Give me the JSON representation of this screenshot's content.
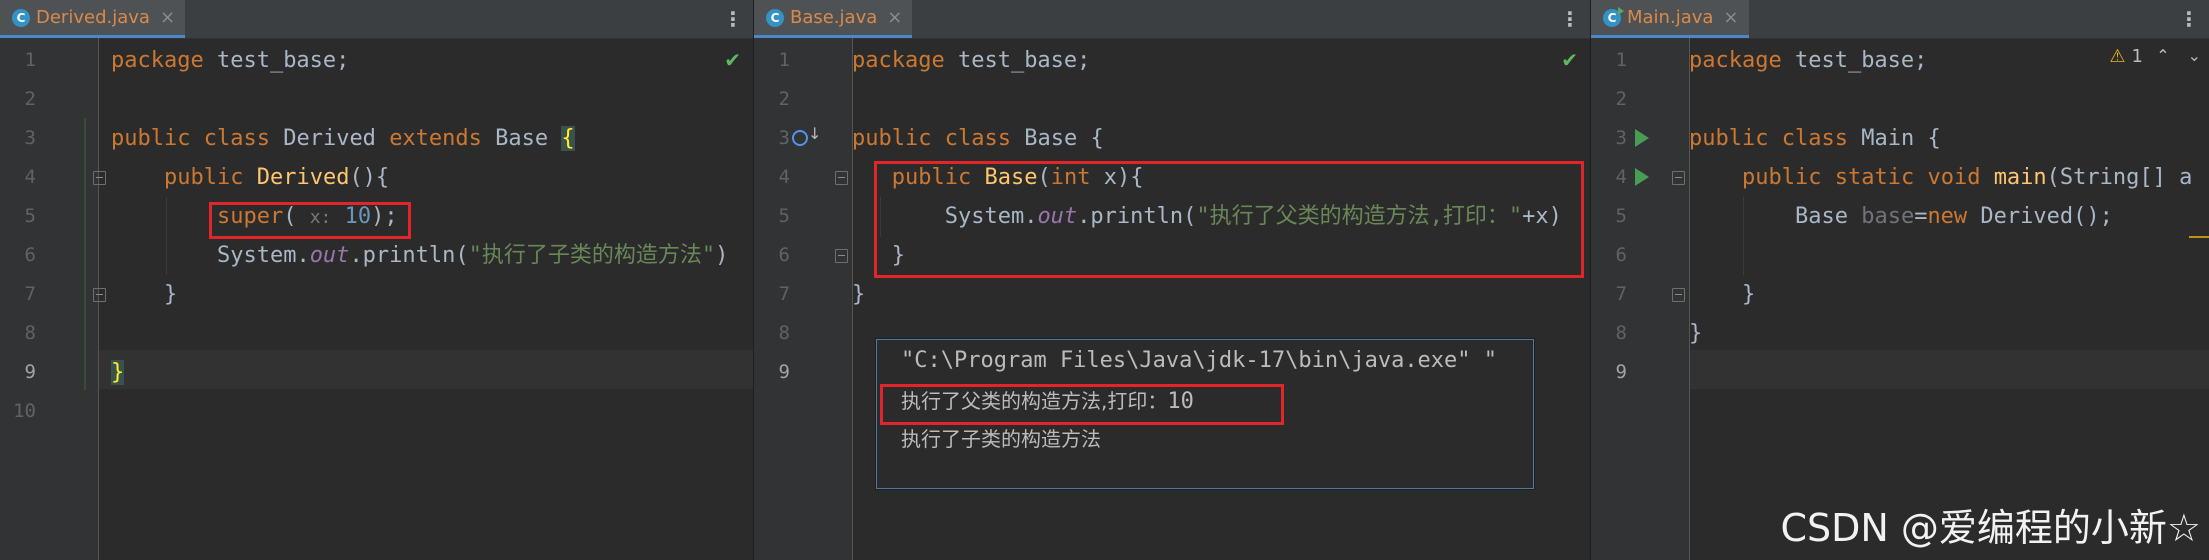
{
  "panes": [
    {
      "tab": {
        "label": "Derived.java",
        "close": "×"
      },
      "menu": "⋮",
      "status_icon": "✔",
      "line_numbers": [
        "1",
        "2",
        "3",
        "4",
        "5",
        "6",
        "7",
        "8",
        "9",
        "10"
      ],
      "code": {
        "l1_kw": "package",
        "l1_rest": " test_base;",
        "l3_kw1": "public",
        "l3_kw2": "class",
        "l3_name": " Derived ",
        "l3_kw3": "extends",
        "l3_base": " Base ",
        "l3_brace": "{",
        "l4_kw": "public",
        "l4_fn": "Derived",
        "l4_rest": "(){",
        "l5_super": "super",
        "l5_paren": "( ",
        "l5_hint": "x:",
        "l5_num": " 10",
        "l5_end": ");",
        "l6_a": "System.",
        "l6_out": "out",
        "l6_b": ".println(",
        "l6_str": "\"执行了子类的构造方法\"",
        "l6_c": ")",
        "l7": "}",
        "l9": "}"
      }
    },
    {
      "tab": {
        "label": "Base.java",
        "close": "×"
      },
      "menu": "⋮",
      "status_icon": "✔",
      "line_numbers": [
        "1",
        "2",
        "3",
        "4",
        "5",
        "6",
        "7",
        "8",
        "9"
      ],
      "code": {
        "l1_kw": "package",
        "l1_rest": " test_base;",
        "l3_kw1": "public",
        "l3_kw2": "class",
        "l3_rest": " Base {",
        "l4_kw": "public",
        "l4_fn": "Base",
        "l4_a": "(",
        "l4_int": "int",
        "l4_b": " x){",
        "l5_a": "System.",
        "l5_out": "out",
        "l5_b": ".println(",
        "l5_str": "\"执行了父类的构造方法,打印：\"",
        "l5_c": "+x)",
        "l6": "}",
        "l7": "}"
      }
    },
    {
      "tab": {
        "label": "Main.java",
        "close": "×"
      },
      "menu": "⋮",
      "warning_count": "1",
      "warning_icon": "⚠",
      "nav_up": "⌃",
      "nav_down": "⌄",
      "line_numbers": [
        "1",
        "2",
        "3",
        "4",
        "5",
        "6",
        "7",
        "8",
        "9"
      ],
      "code": {
        "l1_kw": "package",
        "l1_rest": " test_base;",
        "l3_kw1": "public",
        "l3_kw2": "class",
        "l3_rest": " Main {",
        "l4_kw1": "public",
        "l4_kw2": "static",
        "l4_kw3": "void",
        "l4_fn": "main",
        "l4_rest": "(String[] a",
        "l5_a": "Base ",
        "l5_var": "base",
        "l5_b": "=",
        "l5_new": "new",
        "l5_c": " Derived();",
        "l7": "}",
        "l8": "}"
      }
    }
  ],
  "console_popup": {
    "line1": "\"C:\\Program Files\\Java\\jdk-17\\bin\\java.exe\" \"",
    "line2_cn": "执行了父类的构造方法,打印：",
    "line2_num": "10",
    "line3": "执行了子类的构造方法"
  },
  "watermark": "CSDN @爱编程的小新☆",
  "colors": {
    "editor_bg": "#2b2b2b",
    "keyword": "#cc7832",
    "function": "#ffc66d",
    "string": "#6a8759",
    "number": "#6897bb",
    "highlight_box": "#e0262b"
  }
}
